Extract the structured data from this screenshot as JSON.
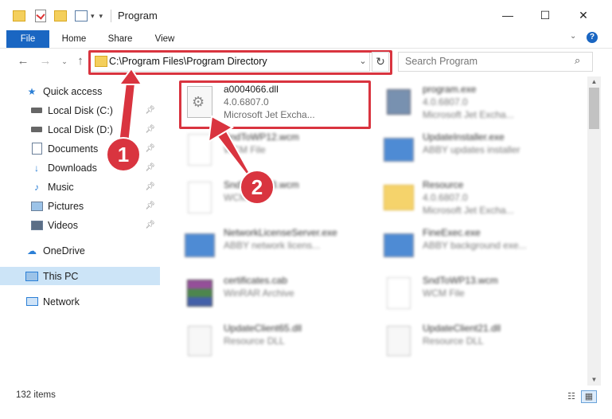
{
  "window": {
    "title": "Program",
    "minimize": "—",
    "maximize": "☐",
    "close": "✕"
  },
  "ribbon": {
    "tabs": [
      "File",
      "Home",
      "Share",
      "View"
    ]
  },
  "address": {
    "path": "C:\\Program Files\\Program Directory",
    "search_placeholder": "Search Program"
  },
  "nav": {
    "quick_access": "Quick access",
    "items": [
      {
        "label": "Local Disk (C:)",
        "icon": "drive-icon",
        "pinned": true
      },
      {
        "label": "Local Disk (D:)",
        "icon": "drive-icon",
        "pinned": true
      },
      {
        "label": "Documents",
        "icon": "documents-icon",
        "pinned": true
      },
      {
        "label": "Downloads",
        "icon": "downloads-icon",
        "pinned": true
      },
      {
        "label": "Music",
        "icon": "music-icon",
        "pinned": true
      },
      {
        "label": "Pictures",
        "icon": "pictures-icon",
        "pinned": true
      },
      {
        "label": "Videos",
        "icon": "videos-icon",
        "pinned": true
      }
    ],
    "onedrive": "OneDrive",
    "this_pc": "This PC",
    "network": "Network"
  },
  "files": [
    {
      "name": "a0004066.dll",
      "line2": "4.0.6807.0",
      "line3": "Microsoft Jet Excha...",
      "icon": "dll-gear-icon"
    },
    {
      "name": "program.exe",
      "line2": "4.0.6807.0",
      "line3": "Microsoft Jet Excha...",
      "icon": "exe-icon"
    },
    {
      "name": "SndToWP12.wcm",
      "line2": "WCM File",
      "line3": "",
      "icon": "blank-file-icon"
    },
    {
      "name": "UpdateInstaller.exe",
      "line2": "ABBY updates installer",
      "line3": "",
      "icon": "window-app-icon"
    },
    {
      "name": "SndToWP13.wcm",
      "line2": "WCM File",
      "line3": "",
      "icon": "blank-file-icon"
    },
    {
      "name": "Resource",
      "line2": "4.0.6807.0",
      "line3": "Microsoft Jet Excha...",
      "icon": "folder-icon"
    },
    {
      "name": "NetworkLicenseServer.exe",
      "line2": "ABBY network licens...",
      "line3": "",
      "icon": "window-app-icon"
    },
    {
      "name": "FineExec.exe",
      "line2": "ABBY background exe...",
      "line3": "",
      "icon": "window-app-icon"
    },
    {
      "name": "certificates.cab",
      "line2": "WinRAR Archive",
      "line3": "",
      "icon": "archive-icon"
    },
    {
      "name": "SndToWP13.wcm",
      "line2": "WCM File",
      "line3": "",
      "icon": "blank-file-icon"
    },
    {
      "name": "UpdateClient65.dll",
      "line2": "Resource DLL",
      "line3": "",
      "icon": "dll-gear-icon"
    },
    {
      "name": "UpdateClient21.dll",
      "line2": "Resource DLL",
      "line3": "",
      "icon": "dll-gear-icon"
    }
  ],
  "status": {
    "count": "132 items"
  },
  "annotations": {
    "step1": "1",
    "step2": "2"
  },
  "colors": {
    "annotation_red": "#d9343f",
    "file_tab_blue": "#1a66c2",
    "selection_blue": "#cce4f7"
  }
}
